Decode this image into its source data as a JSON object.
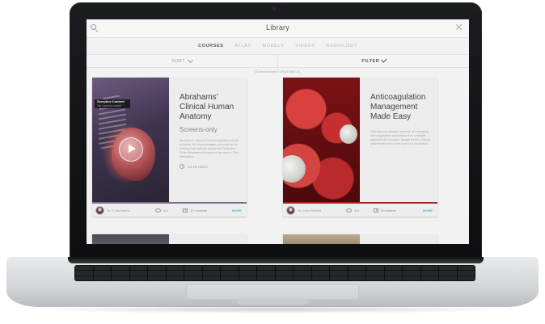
{
  "window": {
    "title": "Library"
  },
  "tabs": [
    {
      "label": "COURSES",
      "active": true
    },
    {
      "label": "ATLAS",
      "active": false
    },
    {
      "label": "MODELS",
      "active": false
    },
    {
      "label": "VIDEOS",
      "active": false
    },
    {
      "label": "RADIOLOGY",
      "active": false
    }
  ],
  "sort": {
    "label": "SORT"
  },
  "filter": {
    "label": "FILTER"
  },
  "results_text": "16 items found in ANATOMICAL",
  "cards": [
    {
      "title": "Abrahams' Clinical Human Anatomy",
      "subtitle": "Screens-only",
      "description": "Abrahams' Clinical Human Anatomy course includes 18 clinical images collected by the leading international anatomist Professor Peter Abrahams throughout his career. This interactive...",
      "duration": "10-15 Hours",
      "sensitive_title": "Sensitive Content",
      "sensitive_sub": "Tap content to reveal",
      "author": "Dr. P. Abrahams",
      "rating": "4.4",
      "lectures": "32 Lectures",
      "more": "MORE",
      "accent": "#7b6c93",
      "icons": [
        "play-icon",
        "clock-icon",
        "eye-icon",
        "lecture-icon"
      ]
    },
    {
      "title": "Anticoagulation Management Made Easy",
      "subtitle": "",
      "description": "Take the complicated process of managing anticoagulation and reduce it to a simple algorithm for success. Taught by two clinical pharmacists who both work in a dedicated...",
      "duration": "",
      "author": "Dr. John Russell",
      "rating": "4.6",
      "lectures": "5 Lectures",
      "more": "MORE",
      "accent": "#b02125",
      "icons": [
        "eye-icon",
        "lecture-icon"
      ]
    }
  ],
  "colors": {
    "more_link": "#3ec2c8",
    "screen_bg": "#f2f2f2",
    "laptop_bezel": "#111214"
  }
}
